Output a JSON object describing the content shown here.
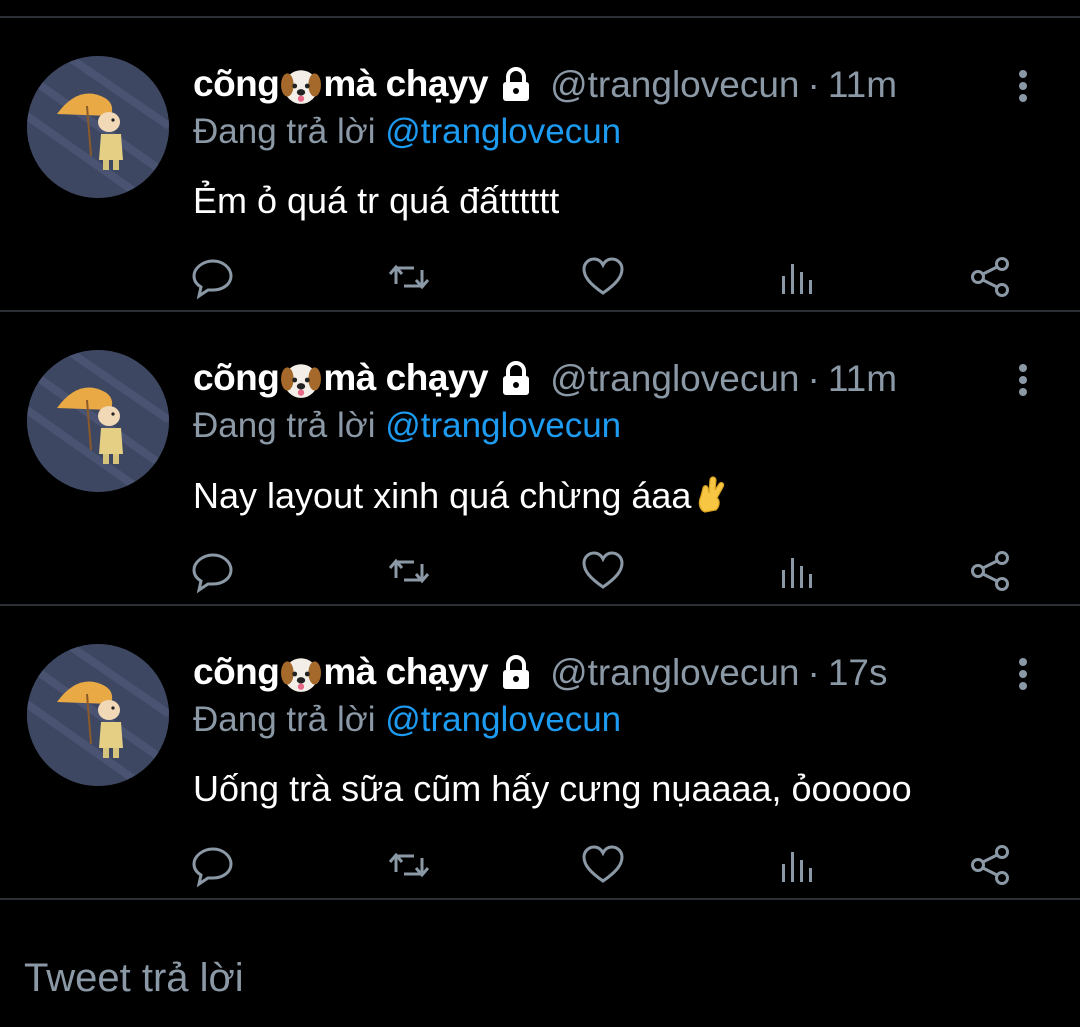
{
  "thread": {
    "tweets": [
      {
        "display_name_1": "cõng",
        "display_name_2": "mà chạyy",
        "handle": "@tranglovecun",
        "separator": "·",
        "time": "11m",
        "replying_prefix": "Đang trả lời",
        "replying_to": "@tranglovecun",
        "text": "Ẻm ỏ quá tr quá đấtttttt",
        "has_emoji": false
      },
      {
        "display_name_1": "cõng",
        "display_name_2": "mà chạyy",
        "handle": "@tranglovecun",
        "separator": "·",
        "time": "11m",
        "replying_prefix": "Đang trả lời",
        "replying_to": "@tranglovecun",
        "text": "Nay layout xinh quá chừng áaa",
        "has_emoji": true
      },
      {
        "display_name_1": "cõng",
        "display_name_2": "mà chạyy",
        "handle": "@tranglovecun",
        "separator": "·",
        "time": "17s",
        "replying_prefix": "Đang trả lời",
        "replying_to": "@tranglovecun",
        "text": "Uống trà sữa cũm hấy cưng nụaaaa, ỏooooo",
        "has_emoji": false
      }
    ],
    "action_icons": [
      "reply-icon",
      "retweet-icon",
      "like-icon",
      "analytics-icon",
      "share-icon"
    ]
  },
  "composer": {
    "placeholder": "Tweet trả lời"
  },
  "colors": {
    "background": "#000000",
    "text": "#ffffff",
    "secondary": "#8b98a5",
    "mention": "#1d9bf0",
    "divider": "#2b2e33"
  }
}
